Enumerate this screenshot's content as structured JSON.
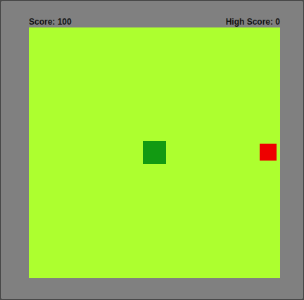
{
  "score": {
    "label": "Score: 100"
  },
  "high_score": {
    "label": "High Score: 0"
  },
  "pieces": [
    {
      "kind": "snake",
      "color": "#129a12"
    },
    {
      "kind": "food",
      "color": "#ee0000"
    }
  ]
}
